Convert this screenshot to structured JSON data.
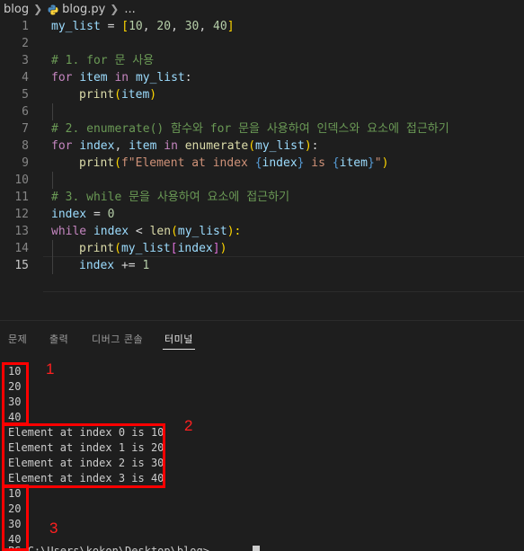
{
  "breadcrumb": {
    "folder": "blog",
    "file": "blog.py",
    "more": "..."
  },
  "editor": {
    "line_numbers": [
      "1",
      "2",
      "3",
      "4",
      "5",
      "6",
      "7",
      "8",
      "9",
      "10",
      "11",
      "12",
      "13",
      "14",
      "15"
    ],
    "active_line": "15",
    "code": {
      "l1": {
        "a": "my_list",
        "b": " = ",
        "c": "[",
        "d": "10",
        "e": ", ",
        "f": "20",
        "g": ", ",
        "h": "30",
        "i": ", ",
        "j": "40",
        "k": "]"
      },
      "l3": "# 1. for 문 사용",
      "l4": {
        "a": "for",
        "b": " ",
        "c": "item",
        "d": " ",
        "e": "in",
        "f": " ",
        "g": "my_list",
        "h": ":"
      },
      "l5": {
        "a": "print",
        "b": "(",
        "c": "item",
        "d": ")"
      },
      "l7": "# 2. enumerate() 함수와 for 문을 사용하여 인덱스와 요소에 접근하기",
      "l8": {
        "a": "for",
        "b": " ",
        "c": "index",
        "d": ", ",
        "e": "item",
        "f": " ",
        "g": "in",
        "h": " ",
        "i": "enumerate",
        "j": "(",
        "k": "my_list",
        "l": ")",
        "m": ":"
      },
      "l9": {
        "a": "print",
        "b": "(",
        "c": "f\"Element at index ",
        "d": "{",
        "e": "index",
        "f": "}",
        "g": " is ",
        "h": "{",
        "i": "item",
        "j": "}",
        "k": "\"",
        "l": ")"
      },
      "l11": "# 3. while 문을 사용하여 요소에 접근하기",
      "l12": {
        "a": "index",
        "b": " = ",
        "c": "0"
      },
      "l13": {
        "a": "while",
        "b": " ",
        "c": "index",
        "d": " < ",
        "e": "len",
        "f": "(",
        "g": "my_list",
        "h": "):"
      },
      "l14": {
        "a": "print",
        "b": "(",
        "c": "my_list",
        "d": "[",
        "e": "index",
        "f": "]",
        "g": ")"
      },
      "l15": {
        "a": "index",
        "b": " += ",
        "c": "1"
      }
    }
  },
  "panel": {
    "tabs": [
      "문제",
      "출력",
      "디버그 콘솔",
      "터미널"
    ],
    "active_tab": "터미널"
  },
  "terminal": {
    "lines": [
      "10",
      "20",
      "30",
      "40",
      "Element at index 0 is 10",
      "Element at index 1 is 20",
      "Element at index 2 is 30",
      "Element at index 3 is 40",
      "10",
      "20",
      "30",
      "40"
    ],
    "prompt_partial": "PS C:\\Users\\kokon\\Desktop\\blog> "
  },
  "annotations": [
    "1",
    "2",
    "3"
  ],
  "colors": {
    "annotation": "#ff0000",
    "background": "#1e1e1e",
    "keyword_control": "#c586c0",
    "comment": "#6a9955"
  }
}
